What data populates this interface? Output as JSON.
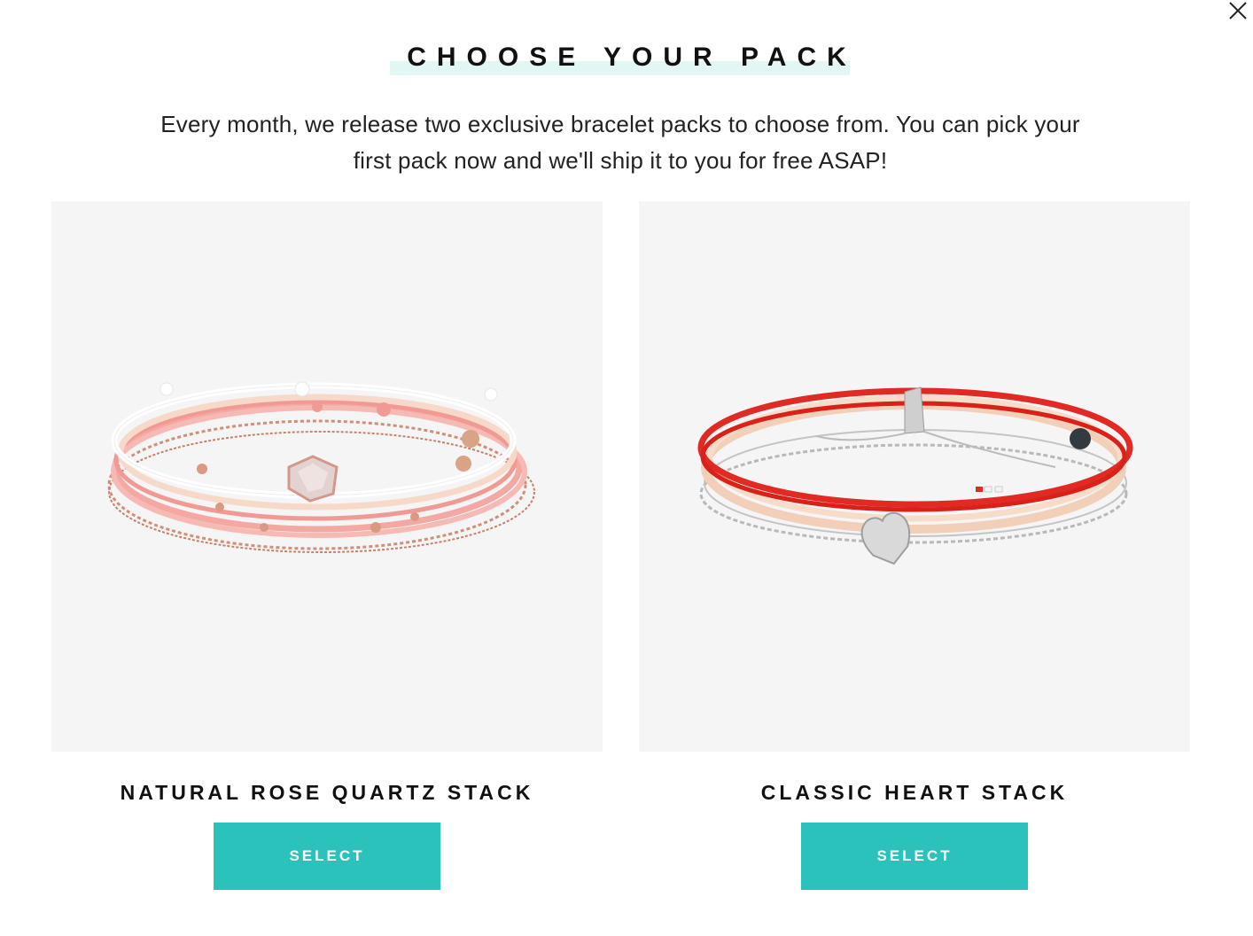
{
  "modal": {
    "title": "CHOOSE YOUR PACK",
    "subtitle": "Every month, we release two exclusive bracelet packs to choose from. You can pick your first pack now and we'll ship it to you for free ASAP!",
    "close_icon": "close-icon"
  },
  "packs": [
    {
      "name": "NATURAL ROSE QUARTZ STACK",
      "button_label": "SELECT",
      "image_alt": "Natural Rose Quartz Stack bracelets"
    },
    {
      "name": "CLASSIC HEART STACK",
      "button_label": "SELECT",
      "image_alt": "Classic Heart Stack bracelets"
    }
  ],
  "colors": {
    "accent": "#2bc2bc",
    "title_highlight": "#e2f6f4",
    "image_bg": "#f5f5f5"
  }
}
